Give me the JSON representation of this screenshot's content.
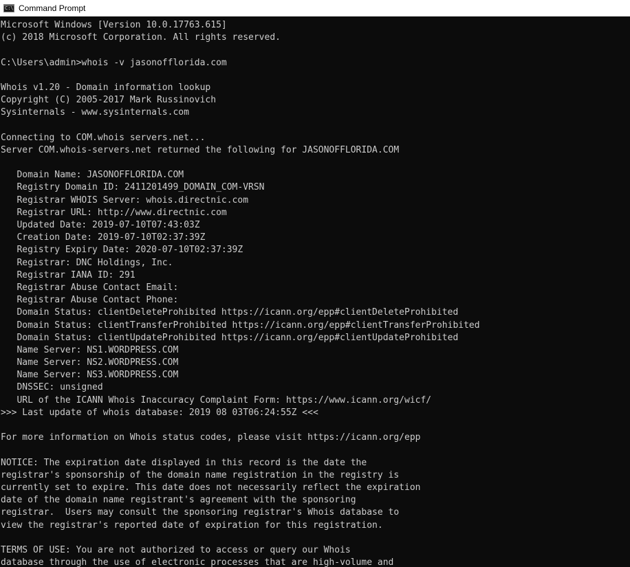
{
  "window": {
    "title": "Command Prompt",
    "icon": "cmd-icon",
    "colors": {
      "background": "#0c0c0c",
      "text": "#cccccc",
      "titlebar": "#ffffff"
    }
  },
  "console": {
    "lines": [
      "Microsoft Windows [Version 10.0.17763.615]",
      "(c) 2018 Microsoft Corporation. All rights reserved.",
      "",
      "C:\\Users\\admin>whois -v jasonofflorida.com",
      "",
      "Whois v1.20 - Domain information lookup",
      "Copyright (C) 2005-2017 Mark Russinovich",
      "Sysinternals - www.sysinternals.com",
      "",
      "Connecting to COM.whois servers.net...",
      "Server COM.whois-servers.net returned the following for JASONOFFLORIDA.COM",
      "",
      "   Domain Name: JASONOFFLORIDA.COM",
      "   Registry Domain ID: 2411201499_DOMAIN_COM-VRSN",
      "   Registrar WHOIS Server: whois.directnic.com",
      "   Registrar URL: http://www.directnic.com",
      "   Updated Date: 2019-07-10T07:43:03Z",
      "   Creation Date: 2019-07-10T02:37:39Z",
      "   Registry Expiry Date: 2020-07-10T02:37:39Z",
      "   Registrar: DNC Holdings, Inc.",
      "   Registrar IANA ID: 291",
      "   Registrar Abuse Contact Email:",
      "   Registrar Abuse Contact Phone:",
      "   Domain Status: clientDeleteProhibited https://icann.org/epp#clientDeleteProhibited",
      "   Domain Status: clientTransferProhibited https://icann.org/epp#clientTransferProhibited",
      "   Domain Status: clientUpdateProhibited https://icann.org/epp#clientUpdateProhibited",
      "   Name Server: NS1.WORDPRESS.COM",
      "   Name Server: NS2.WORDPRESS.COM",
      "   Name Server: NS3.WORDPRESS.COM",
      "   DNSSEC: unsigned",
      "   URL of the ICANN Whois Inaccuracy Complaint Form: https://www.icann.org/wicf/",
      ">>> Last update of whois database: 2019 08 03T06:24:55Z <<<",
      "",
      "For more information on Whois status codes, please visit https://icann.org/epp",
      "",
      "NOTICE: The expiration date displayed in this record is the date the",
      "registrar's sponsorship of the domain name registration in the registry is",
      "currently set to expire. This date does not necessarily reflect the expiration",
      "date of the domain name registrant's agreement with the sponsoring",
      "registrar.  Users may consult the sponsoring registrar's Whois database to",
      "view the registrar's reported date of expiration for this registration.",
      "",
      "TERMS OF USE: You are not authorized to access or query our Whois",
      "database through the use of electronic processes that are high-volume and"
    ]
  }
}
